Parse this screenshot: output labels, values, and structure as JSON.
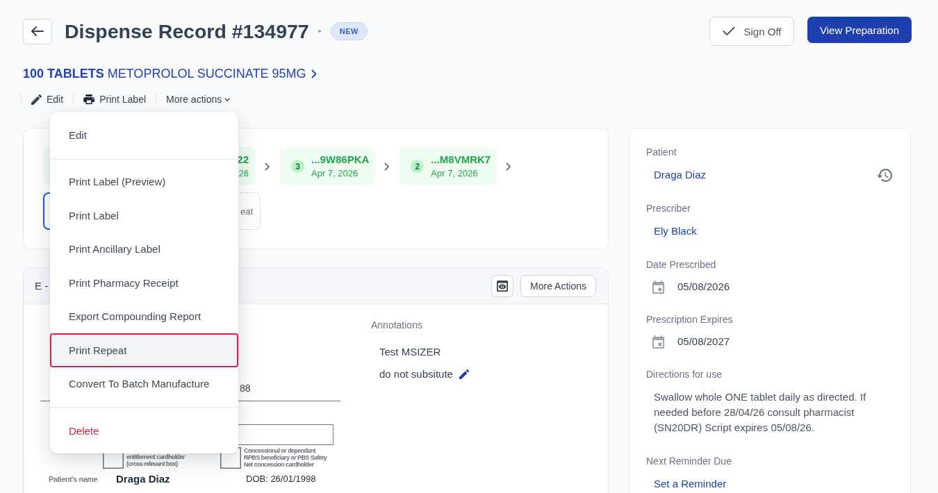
{
  "header": {
    "title": "Dispense Record #134977",
    "status": "NEW",
    "actions": [
      {
        "kind": "sign_off",
        "label": "Sign Off"
      },
      {
        "kind": "primary",
        "label": "View Preparation"
      }
    ]
  },
  "product": {
    "text": "**100 TABLETS** METOPROLOL SUCCINATE 95MG"
  },
  "toolbar": {
    "edit": "Edit",
    "print_label": "Print Label",
    "more_actions": {
      "label": "More actions",
      "expanded": true
    }
  },
  "menu": {
    "groups": [
      [
        {
          "label": "Edit",
          "kind": "normal",
          "highlighted": false
        }
      ],
      [
        {
          "label": "Print Label (Preview)",
          "kind": "normal",
          "highlighted": false
        },
        {
          "label": "Print Label",
          "kind": "normal",
          "highlighted": false
        },
        {
          "label": "Print Ancillary Label",
          "kind": "normal",
          "highlighted": false
        },
        {
          "label": "Print Pharmacy Receipt",
          "kind": "normal",
          "highlighted": false
        },
        {
          "label": "Export Compounding Report",
          "kind": "normal",
          "highlighted": false
        },
        {
          "label": "Print Repeat",
          "kind": "normal",
          "highlighted": true
        },
        {
          "label": "Convert To Batch Manufacture",
          "kind": "normal",
          "highlighted": false
        }
      ],
      [
        {
          "label": "Delete",
          "kind": "danger",
          "highlighted": false
        }
      ]
    ]
  },
  "repeat_chain": {
    "steps": [
      {
        "code": "22",
        "date": "26"
      },
      {
        "number": "3",
        "code": "...9W86PKA",
        "date": "Apr 7, 2026"
      },
      {
        "number": "2",
        "code": "...M8VMRK7",
        "date": "Apr 7, 2026"
      }
    ],
    "current": {
      "selected": true
    },
    "action": {
      "label": "eat"
    }
  },
  "document": {
    "title": "E -",
    "more_actions": "More Actions",
    "form": {
      "fragment": "88",
      "checkboxes": [
        {
          "checked": false,
          "lines": [
            "entitlement cardholder",
            "(cross relevant box)"
          ]
        },
        {
          "checked": false,
          "lines": [
            "Concessional or dependant",
            "RPBS beneficiary or PBS Safety",
            "Net concession cardholder"
          ]
        }
      ],
      "patient_label": "Patient's name",
      "patient_name": "Draga Diaz",
      "dob": "DOB: 26/01/1998"
    },
    "annotations": {
      "title": "Annotations",
      "items": [
        {
          "text": "Test MSIZER",
          "editable": false
        },
        {
          "text": "do not subsitute",
          "editable": true
        }
      ]
    }
  },
  "details": [
    {
      "label": "Patient",
      "kind": "person_link",
      "value": "Draga Diaz"
    },
    {
      "label": "Prescriber",
      "kind": "link",
      "value": "Ely Black"
    },
    {
      "label": "Date Prescribed",
      "kind": "date",
      "value": "05/08/2026"
    },
    {
      "label": "Prescription Expires",
      "kind": "date",
      "value": "05/08/2027"
    },
    {
      "label": "Directions for use",
      "kind": "text",
      "value": "Swallow whole ONE tablet daily as directed. If needed before 28/04/26 consult pharmacist (SN20DR) Script expires 05/08/26."
    },
    {
      "label": "Next Reminder Due",
      "kind": "link",
      "value": "Set a Reminder"
    }
  ]
}
